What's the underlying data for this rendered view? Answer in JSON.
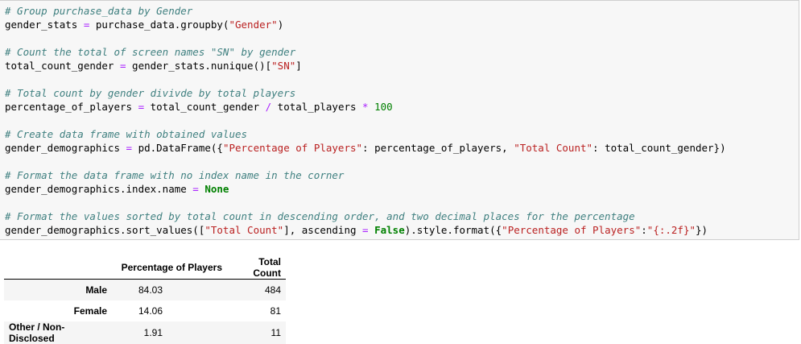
{
  "code_cell": {
    "lines": [
      [
        {
          "t": "c",
          "v": "# Group purchase_data by Gender"
        }
      ],
      [
        {
          "t": "",
          "v": "gender_stats "
        },
        {
          "t": "o",
          "v": "="
        },
        {
          "t": "",
          "v": " purchase_data.groupby("
        },
        {
          "t": "s",
          "v": "\"Gender\""
        },
        {
          "t": "",
          "v": ")"
        }
      ],
      [
        {
          "t": "",
          "v": ""
        }
      ],
      [
        {
          "t": "c",
          "v": "# Count the total of screen names \"SN\" by gender"
        }
      ],
      [
        {
          "t": "",
          "v": "total_count_gender "
        },
        {
          "t": "o",
          "v": "="
        },
        {
          "t": "",
          "v": " gender_stats.nunique()["
        },
        {
          "t": "s",
          "v": "\"SN\""
        },
        {
          "t": "",
          "v": "]"
        }
      ],
      [
        {
          "t": "",
          "v": ""
        }
      ],
      [
        {
          "t": "c",
          "v": "# Total count by gender divivde by total players"
        }
      ],
      [
        {
          "t": "",
          "v": "percentage_of_players "
        },
        {
          "t": "o",
          "v": "="
        },
        {
          "t": "",
          "v": " total_count_gender "
        },
        {
          "t": "o",
          "v": "/"
        },
        {
          "t": "",
          "v": " total_players "
        },
        {
          "t": "o",
          "v": "*"
        },
        {
          "t": "",
          "v": " "
        },
        {
          "t": "n",
          "v": "100"
        }
      ],
      [
        {
          "t": "",
          "v": ""
        }
      ],
      [
        {
          "t": "c",
          "v": "# Create data frame with obtained values"
        }
      ],
      [
        {
          "t": "",
          "v": "gender_demographics "
        },
        {
          "t": "o",
          "v": "="
        },
        {
          "t": "",
          "v": " pd.DataFrame({"
        },
        {
          "t": "s",
          "v": "\"Percentage of Players\""
        },
        {
          "t": "",
          "v": ": percentage_of_players, "
        },
        {
          "t": "s",
          "v": "\"Total Count\""
        },
        {
          "t": "",
          "v": ": total_count_gender})"
        }
      ],
      [
        {
          "t": "",
          "v": ""
        }
      ],
      [
        {
          "t": "c",
          "v": "# Format the data frame with no index name in the corner"
        }
      ],
      [
        {
          "t": "",
          "v": "gender_demographics.index.name "
        },
        {
          "t": "o",
          "v": "="
        },
        {
          "t": "",
          "v": " "
        },
        {
          "t": "k",
          "v": "None"
        }
      ],
      [
        {
          "t": "",
          "v": ""
        }
      ],
      [
        {
          "t": "c",
          "v": "# Format the values sorted by total count in descending order, and two decimal places for the percentage"
        }
      ],
      [
        {
          "t": "",
          "v": "gender_demographics.sort_values(["
        },
        {
          "t": "s",
          "v": "\"Total Count\""
        },
        {
          "t": "",
          "v": "], ascending "
        },
        {
          "t": "o",
          "v": "="
        },
        {
          "t": "",
          "v": " "
        },
        {
          "t": "k",
          "v": "False"
        },
        {
          "t": "",
          "v": ").style.format({"
        },
        {
          "t": "s",
          "v": "\"Percentage of Players\""
        },
        {
          "t": "",
          "v": ":"
        },
        {
          "t": "s",
          "v": "\"{:.2f}\""
        },
        {
          "t": "",
          "v": "})"
        }
      ]
    ]
  },
  "output_table": {
    "columns": [
      "Percentage of Players",
      "Total Count"
    ],
    "rows": [
      {
        "index": "Male",
        "pct": "84.03",
        "count": "484"
      },
      {
        "index": "Female",
        "pct": "14.06",
        "count": "81"
      },
      {
        "index": "Other / Non-Disclosed",
        "pct": "1.91",
        "count": "11"
      }
    ]
  }
}
